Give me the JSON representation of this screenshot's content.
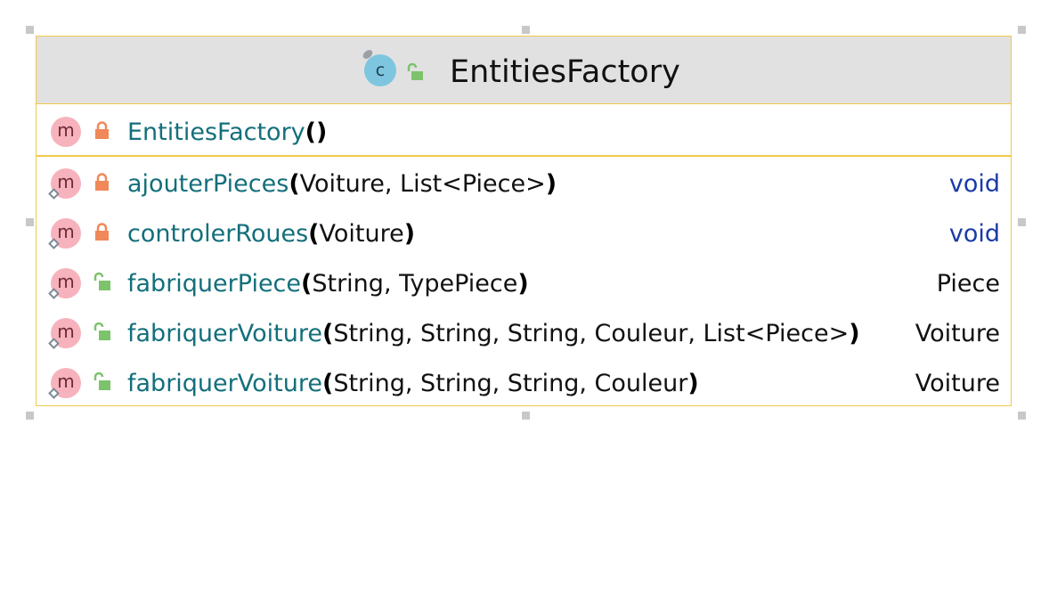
{
  "diagram": {
    "class_name": "EntitiesFactory",
    "class_icon_letter": "c",
    "class_icon": "class-icon",
    "class_visibility": "public",
    "colors": {
      "border": "#f2c94c",
      "header_bg": "#e1e1e1",
      "method_name": "#136f7b",
      "keyword": "#1a3aa8",
      "private_lock": "#f0885a",
      "public_lock": "#7cc36b"
    },
    "constructors": [
      {
        "icon_letter": "m",
        "visibility": "private",
        "name": "EntitiesFactory",
        "open": "(",
        "params": "",
        "close": ")",
        "return_type": ""
      }
    ],
    "methods": [
      {
        "icon_letter": "m",
        "visibility": "private",
        "name": "ajouterPieces",
        "open": "(",
        "params": "Voiture, List<Piece>",
        "close": ")",
        "return_type": "void",
        "return_is_keyword": true
      },
      {
        "icon_letter": "m",
        "visibility": "private",
        "name": "controlerRoues",
        "open": "(",
        "params": "Voiture",
        "close": ")",
        "return_type": "void",
        "return_is_keyword": true
      },
      {
        "icon_letter": "m",
        "visibility": "public",
        "name": "fabriquerPiece",
        "open": "(",
        "params": "String, TypePiece",
        "close": ")",
        "return_type": "Piece",
        "return_is_keyword": false
      },
      {
        "icon_letter": "m",
        "visibility": "public",
        "name": "fabriquerVoiture",
        "open": "(",
        "params": "String, String, String, Couleur, List<Piece>",
        "close": ")",
        "return_type": "Voiture",
        "return_is_keyword": false
      },
      {
        "icon_letter": "m",
        "visibility": "public",
        "name": "fabriquerVoiture",
        "open": "(",
        "params": "String, String, String, Couleur",
        "close": ")",
        "return_type": "Voiture",
        "return_is_keyword": false
      }
    ]
  }
}
